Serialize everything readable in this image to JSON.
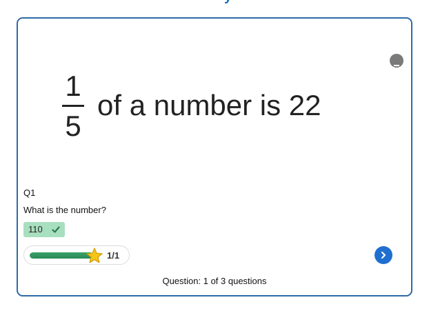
{
  "header": {
    "title_fragment": "y"
  },
  "question": {
    "image": {
      "fraction_numerator": "1",
      "fraction_denominator": "5",
      "expression": "of a number is 22"
    },
    "number": "Q1",
    "prompt": "What is the number?",
    "answer_value": "110",
    "answer_status_icon": "check-icon"
  },
  "progress": {
    "fraction_complete": 1.0,
    "label": "1/1",
    "icon": "star-icon"
  },
  "navigation": {
    "next_icon": "chevron-right-icon"
  },
  "footer": {
    "status": "Question: 1 of 3 questions"
  },
  "colors": {
    "card_border": "#2c6aa6",
    "answer_badge": "#a8dfbf",
    "progress_fill": "#39a169",
    "next_button": "#1f6fd0",
    "star": "#f5c518"
  }
}
